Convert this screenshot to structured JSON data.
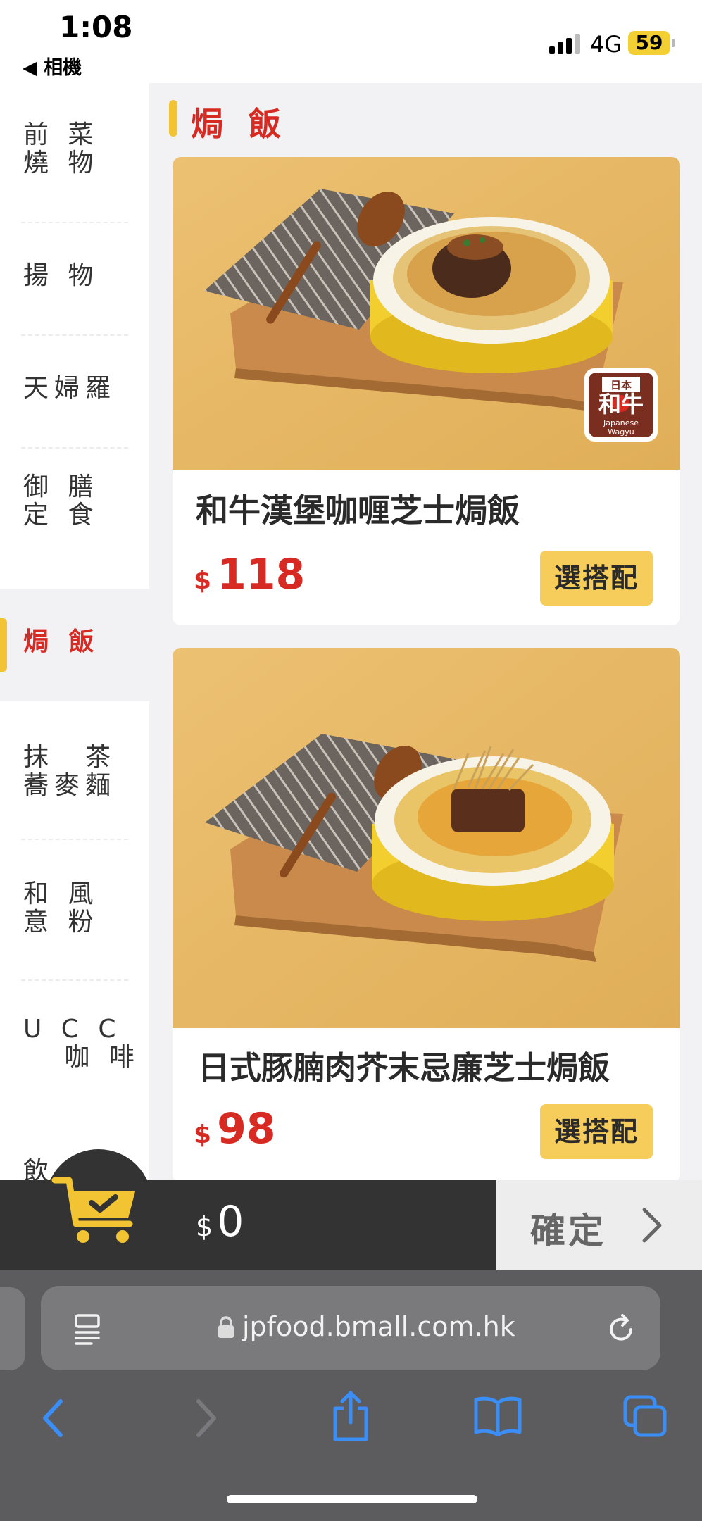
{
  "status_bar": {
    "time": "1:08",
    "back_label": "◀ 相機",
    "network": "4G",
    "battery": "59"
  },
  "sidebar": {
    "items": [
      {
        "label": "前 菜\n燒 物",
        "active": false
      },
      {
        "label": "揚 物",
        "active": false
      },
      {
        "label": "天婦羅",
        "active": false
      },
      {
        "label": "御 膳\n定 食",
        "active": false
      },
      {
        "label": "焗 飯",
        "active": true
      },
      {
        "label": "抹　茶\n蕎麥麵",
        "active": false
      },
      {
        "label": "和 風\n意 粉",
        "active": false
      },
      {
        "label": "U C C\n   咖 啡",
        "active": false
      },
      {
        "label": "飲",
        "active": false
      }
    ]
  },
  "section": {
    "title": "焗 飯"
  },
  "products": [
    {
      "name": "和牛漢堡咖喱芝士焗飯",
      "currency": "$",
      "price": "118",
      "button": "選搭配",
      "badge": {
        "top": "日本",
        "main": "和牛",
        "sub1": "Japanese",
        "sub2": "Wagyu"
      }
    },
    {
      "name": "日式豚腩肉芥末忌廉芝士焗飯",
      "currency": "$",
      "price": "98",
      "button": "選搭配"
    }
  ],
  "cart": {
    "currency": "$",
    "total": "0",
    "confirm_label": "確定"
  },
  "browser": {
    "url": "jpfood.bmall.com.hk"
  },
  "colors": {
    "accent_red": "#d62a22",
    "accent_yellow": "#f2c433",
    "button_yellow": "#f6cd5a",
    "cart_dark": "#333333",
    "ios_blue": "#3a8ef5"
  }
}
